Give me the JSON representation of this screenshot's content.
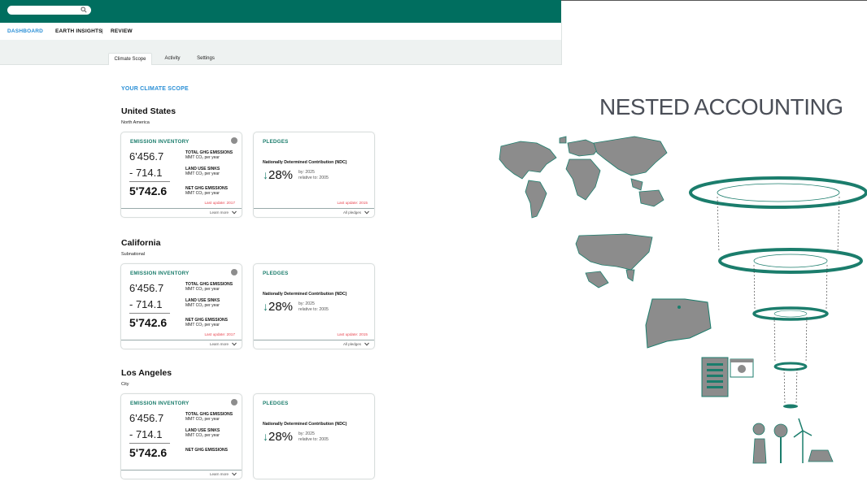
{
  "colors": {
    "brand": "#006e5f",
    "accent": "#2a8fd6",
    "teal": "#1b7d6c",
    "alert": "#e8454f",
    "map_gray": "#8c8c8c"
  },
  "nav": {
    "dashboard": "DASHBOARD",
    "earth_insights": "EARTH INSIGHTS",
    "separator": "|",
    "review": "REVIEW"
  },
  "tabs": [
    "Climate Scope",
    "Activity",
    "Settings"
  ],
  "scope_title": "YOUR CLIMATE SCOPE",
  "regions": [
    {
      "name": "United States",
      "type": "North America",
      "inventory": {
        "title": "EMISSION INVENTORY",
        "total": "6'456.7",
        "sinks": "- 714.1",
        "net": "5'742.6",
        "total_label": "TOTAL GHG EMISSIONS",
        "sinks_label": "LAND USE SINKS",
        "net_label": "NET GHG EMISSIONS",
        "unit": "MMT CO₂ per year",
        "last_update": "Last update: 2017",
        "learn_more": "Learn more"
      },
      "pledges": {
        "title": "PLEDGES",
        "ndc": "Nationally Determined Contribution (NDC)",
        "arrow": "↓",
        "percent": "28%",
        "by": "by: 2025",
        "relative": "relative to: 2005",
        "last_update": "Last update: 2015",
        "all_pledges": "All pledges"
      }
    },
    {
      "name": "California",
      "type": "Subnational",
      "inventory": {
        "title": "EMISSION INVENTORY",
        "total": "6'456.7",
        "sinks": "- 714.1",
        "net": "5'742.6",
        "total_label": "TOTAL GHG EMISSIONS",
        "sinks_label": "LAND USE SINKS",
        "net_label": "NET GHG EMISSIONS",
        "unit": "MMT CO₂ per year",
        "last_update": "Last update: 2017",
        "learn_more": "Learn more"
      },
      "pledges": {
        "title": "PLEDGES",
        "ndc": "Nationally Determined Contribution (NDC)",
        "arrow": "↓",
        "percent": "28%",
        "by": "by: 2025",
        "relative": "relative to: 2005",
        "last_update": "Last update: 2015",
        "all_pledges": "All pledges"
      }
    },
    {
      "name": "Los Angeles",
      "type": "City",
      "inventory": {
        "title": "EMISSION INVENTORY",
        "total": "6'456.7",
        "sinks": "- 714.1",
        "net": "5'742.6",
        "total_label": "TOTAL GHG EMISSIONS",
        "sinks_label": "LAND USE SINKS",
        "net_label": "NET GHG EMISSIONS",
        "unit": "MMT CO₂ per year",
        "learn_more": "Learn more"
      },
      "pledges": {
        "title": "PLEDGES",
        "ndc": "Nationally Determined Contribution (NDC)",
        "arrow": "↓",
        "percent": "28%",
        "by": "by: 2025",
        "relative": "relative to: 2005"
      }
    }
  ],
  "slide": {
    "title": "NESTED ACCOUNTING"
  },
  "icons": [
    "search-icon",
    "info-icon",
    "chevron-down-icon",
    "world-map",
    "usa-map",
    "state-map",
    "building-icon",
    "certificate-icon",
    "nature-energy-icons",
    "nested-rings-diagram"
  ]
}
